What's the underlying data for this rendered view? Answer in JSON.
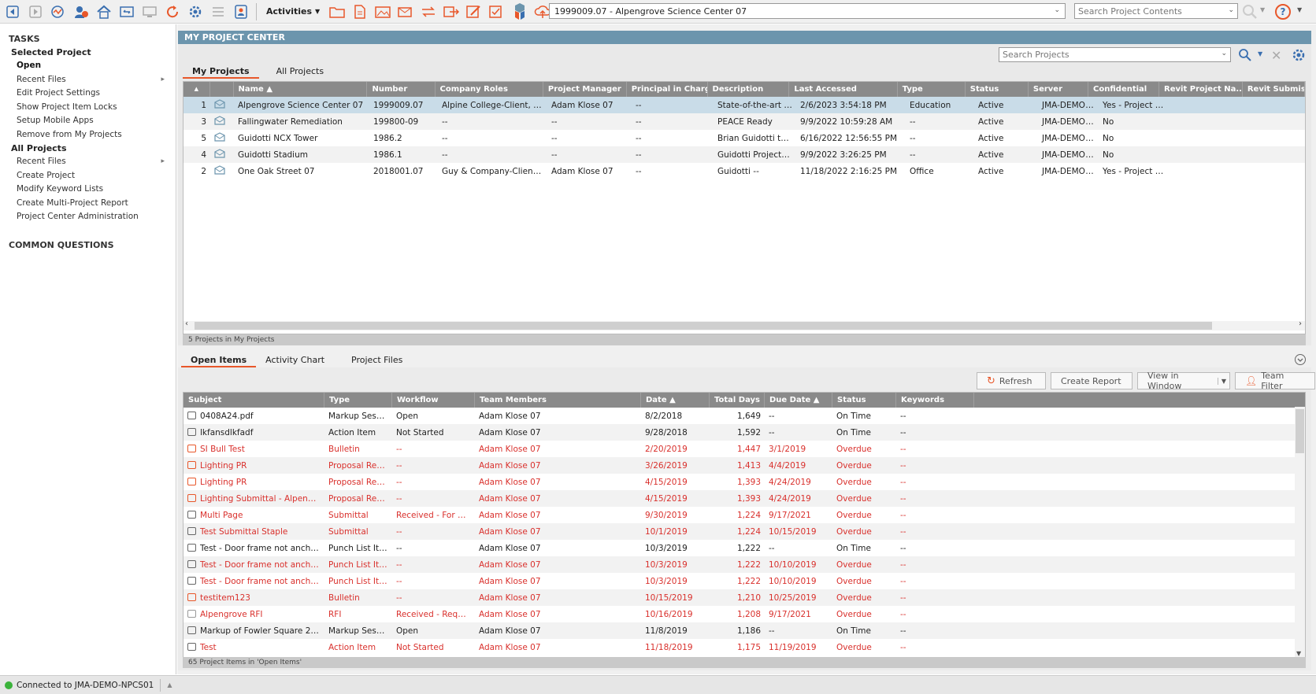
{
  "toolbar": {
    "activities_label": "Activities",
    "project_selector": "1999009.07 - Alpengrove Science Center 07",
    "search_contents_placeholder": "Search Project Contents"
  },
  "sidebar": {
    "tasks_label": "TASKS",
    "selected_project_label": "Selected Project",
    "selected_items": [
      "Open",
      "Recent Files",
      "Edit Project Settings",
      "Show Project Item Locks",
      "Setup Mobile Apps",
      "Remove from My Projects"
    ],
    "all_projects_label": "All Projects",
    "all_items": [
      "Recent Files",
      "Create Project",
      "Modify Keyword Lists",
      "Create Multi-Project Report",
      "Project Center Administration"
    ],
    "common_questions_label": "COMMON QUESTIONS"
  },
  "project_center": {
    "title": "MY PROJECT CENTER",
    "search_placeholder": "Search Projects",
    "tabs": [
      "My Projects",
      "All Projects"
    ],
    "columns": [
      "",
      "",
      "Name",
      "Number",
      "Company Roles",
      "Project Manager",
      "Principal in Charge",
      "Description",
      "Last Accessed",
      "Type",
      "Status",
      "Server",
      "Confidential",
      "Revit Project Na...",
      "Revit Submis"
    ],
    "rows": [
      [
        "1",
        "Alpengrove Science Center 07",
        "1999009.07",
        "Alpine College-Client, Jeff...",
        "Adam Klose 07",
        "--",
        "State-of-the-art E...",
        "2/6/2023 3:54:18 PM",
        "Education",
        "Active",
        "JMA-DEMO-...",
        "Yes - Project T..."
      ],
      [
        "3",
        "Fallingwater Remediation",
        "199800-09",
        "--",
        "--",
        "--",
        "PEACE Ready",
        "9/9/2022 10:59:28 AM",
        "--",
        "Active",
        "JMA-DEMO-...",
        "No"
      ],
      [
        "5",
        "Guidotti NCX Tower",
        "1986.2",
        "--",
        "--",
        "--",
        "Brian Guidotti test...",
        "6/16/2022 12:56:55 PM",
        "--",
        "Active",
        "JMA-DEMO-...",
        "No"
      ],
      [
        "4",
        "Guidotti Stadium",
        "1986.1",
        "--",
        "--",
        "--",
        "Guidotti Project -...",
        "9/9/2022 3:26:25 PM",
        "--",
        "Active",
        "JMA-DEMO-...",
        "No"
      ],
      [
        "2",
        "One Oak Street 07",
        "2018001.07",
        "Guy & Company-Client, I...",
        "Adam Klose 07",
        "--",
        "Guidotti --",
        "11/18/2022 2:16:25 PM",
        "Office",
        "Active",
        "JMA-DEMO-...",
        "Yes - Project T..."
      ]
    ],
    "footer": "5 Projects in My Projects"
  },
  "items_panel": {
    "tabs": [
      "Open Items",
      "Activity Chart",
      "Project Files"
    ],
    "buttons": {
      "refresh": "Refresh",
      "create_report": "Create Report",
      "view_in_window": "View in Window",
      "team_filter": "Team Filter"
    },
    "columns": [
      "Subject",
      "Type",
      "Workflow",
      "Team Members",
      "Date",
      "Total Days",
      "Due Date",
      "Status",
      "Keywords"
    ],
    "rows": [
      {
        "icon": "markup-icon",
        "overdue": false,
        "cells": [
          "0408A24.pdf",
          "Markup Session",
          "Open",
          "Adam Klose 07",
          "8/2/2018",
          "1,649",
          "--",
          "On Time",
          "--"
        ]
      },
      {
        "icon": "action-icon",
        "overdue": false,
        "cells": [
          "lkfansdlkfadf",
          "Action Item",
          "Not Started",
          "Adam Klose 07",
          "9/28/2018",
          "1,592",
          "--",
          "On Time",
          "--"
        ]
      },
      {
        "icon": "bulletin-icon",
        "overdue": true,
        "cells": [
          "SI Bull Test",
          "Bulletin",
          "--",
          "Adam Klose 07",
          "2/20/2019",
          "1,447",
          "3/1/2019",
          "Overdue",
          "--"
        ]
      },
      {
        "icon": "proposal-icon",
        "overdue": true,
        "cells": [
          "Lighting PR",
          "Proposal Request",
          "--",
          "Adam Klose 07",
          "3/26/2019",
          "1,413",
          "4/4/2019",
          "Overdue",
          "--"
        ]
      },
      {
        "icon": "proposal-icon",
        "overdue": true,
        "cells": [
          "Lighting PR",
          "Proposal Request",
          "--",
          "Adam Klose 07",
          "4/15/2019",
          "1,393",
          "4/24/2019",
          "Overdue",
          "--"
        ]
      },
      {
        "icon": "proposal-icon",
        "overdue": true,
        "cells": [
          "Lighting Submittal - Alpengrov...",
          "Proposal Request",
          "--",
          "Adam Klose 07",
          "4/15/2019",
          "1,393",
          "4/24/2019",
          "Overdue",
          "--"
        ]
      },
      {
        "icon": "submittal-icon",
        "overdue": true,
        "cells": [
          "Multi Page",
          "Submittal",
          "Received - For Re...",
          "Adam Klose 07",
          "9/30/2019",
          "1,224",
          "9/17/2021",
          "Overdue",
          "--"
        ]
      },
      {
        "icon": "submittal-icon",
        "overdue": true,
        "cells": [
          "Test Submittal Staple",
          "Submittal",
          "--",
          "Adam Klose 07",
          "10/1/2019",
          "1,224",
          "10/15/2019",
          "Overdue",
          "--"
        ]
      },
      {
        "icon": "punch-icon",
        "overdue": false,
        "cells": [
          "Test - Door frame not anchored",
          "Punch List Item",
          "--",
          "Adam Klose 07",
          "10/3/2019",
          "1,222",
          "--",
          "On Time",
          "--"
        ]
      },
      {
        "icon": "punch-icon",
        "overdue": true,
        "cells": [
          "Test - Door frame not anchored",
          "Punch List Item",
          "--",
          "Adam Klose 07",
          "10/3/2019",
          "1,222",
          "10/10/2019",
          "Overdue",
          "--"
        ]
      },
      {
        "icon": "punch-icon",
        "overdue": true,
        "cells": [
          "Test - Door frame not anchored",
          "Punch List Item",
          "--",
          "Adam Klose 07",
          "10/3/2019",
          "1,222",
          "10/10/2019",
          "Overdue",
          "--"
        ]
      },
      {
        "icon": "bulletin-icon",
        "overdue": true,
        "cells": [
          "testitem123",
          "Bulletin",
          "--",
          "Adam Klose 07",
          "10/15/2019",
          "1,210",
          "10/25/2019",
          "Overdue",
          "--"
        ]
      },
      {
        "icon": "rfi-icon",
        "overdue": true,
        "cells": [
          "Alpengrove RFI",
          "RFI",
          "Received - Reques...",
          "Adam Klose 07",
          "10/16/2019",
          "1,208",
          "9/17/2021",
          "Overdue",
          "--"
        ]
      },
      {
        "icon": "markup-icon",
        "overdue": false,
        "cells": [
          "Markup of Fowler Square 2020",
          "Markup Session",
          "Open",
          "Adam Klose 07",
          "11/8/2019",
          "1,186",
          "--",
          "On Time",
          "--"
        ]
      },
      {
        "icon": "action-icon",
        "overdue": true,
        "cells": [
          "Test",
          "Action Item",
          "Not Started",
          "Adam Klose 07",
          "11/18/2019",
          "1,175",
          "11/19/2019",
          "Overdue",
          "--"
        ]
      }
    ],
    "footer": "65 Project Items in 'Open Items'"
  },
  "status_bar": {
    "text": "Connected to JMA-DEMO-NPCS01"
  },
  "colors": {
    "accent": "#e8572a",
    "header_blue": "#6c95ad",
    "overdue_red": "#d9302c",
    "selected_row": "#c9dce8"
  }
}
